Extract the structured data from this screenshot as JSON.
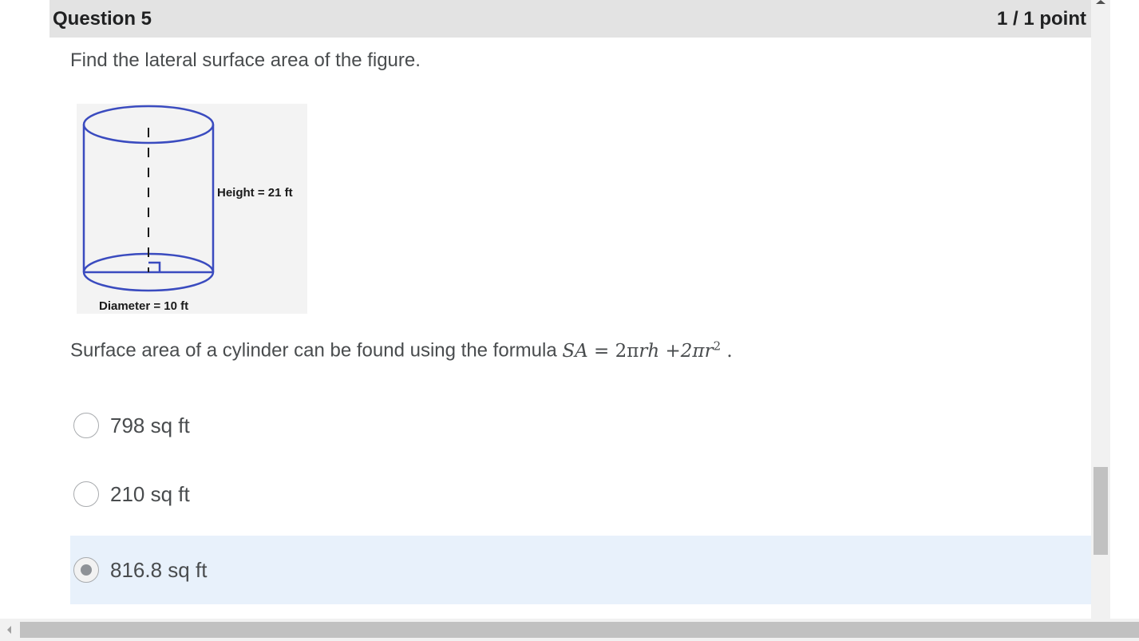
{
  "question": {
    "title": "Question 5",
    "score": "1 / 1 point",
    "prompt": "Find the lateral surface area of the figure."
  },
  "figure": {
    "height_label": "Height = 21 ft",
    "diameter_label": "Diameter = 10 ft",
    "line_color": "#3a4bbf"
  },
  "formula": {
    "text": "Surface area of a cylinder can be found using the formula ",
    "lhs": "SA",
    "equals": " =  ",
    "two_pi": "2π",
    "rh": "rh",
    "plus": " +2π",
    "r": "r",
    "exp": "2",
    "end": " ."
  },
  "options": [
    {
      "label": "798 sq ft",
      "selected": false
    },
    {
      "label": "210 sq ft",
      "selected": false
    },
    {
      "label": "816.8 sq ft",
      "selected": true
    }
  ],
  "colors": {
    "header_bg": "#e3e3e3",
    "selected_bg": "#e8f1fb",
    "text": "#494c4e"
  }
}
